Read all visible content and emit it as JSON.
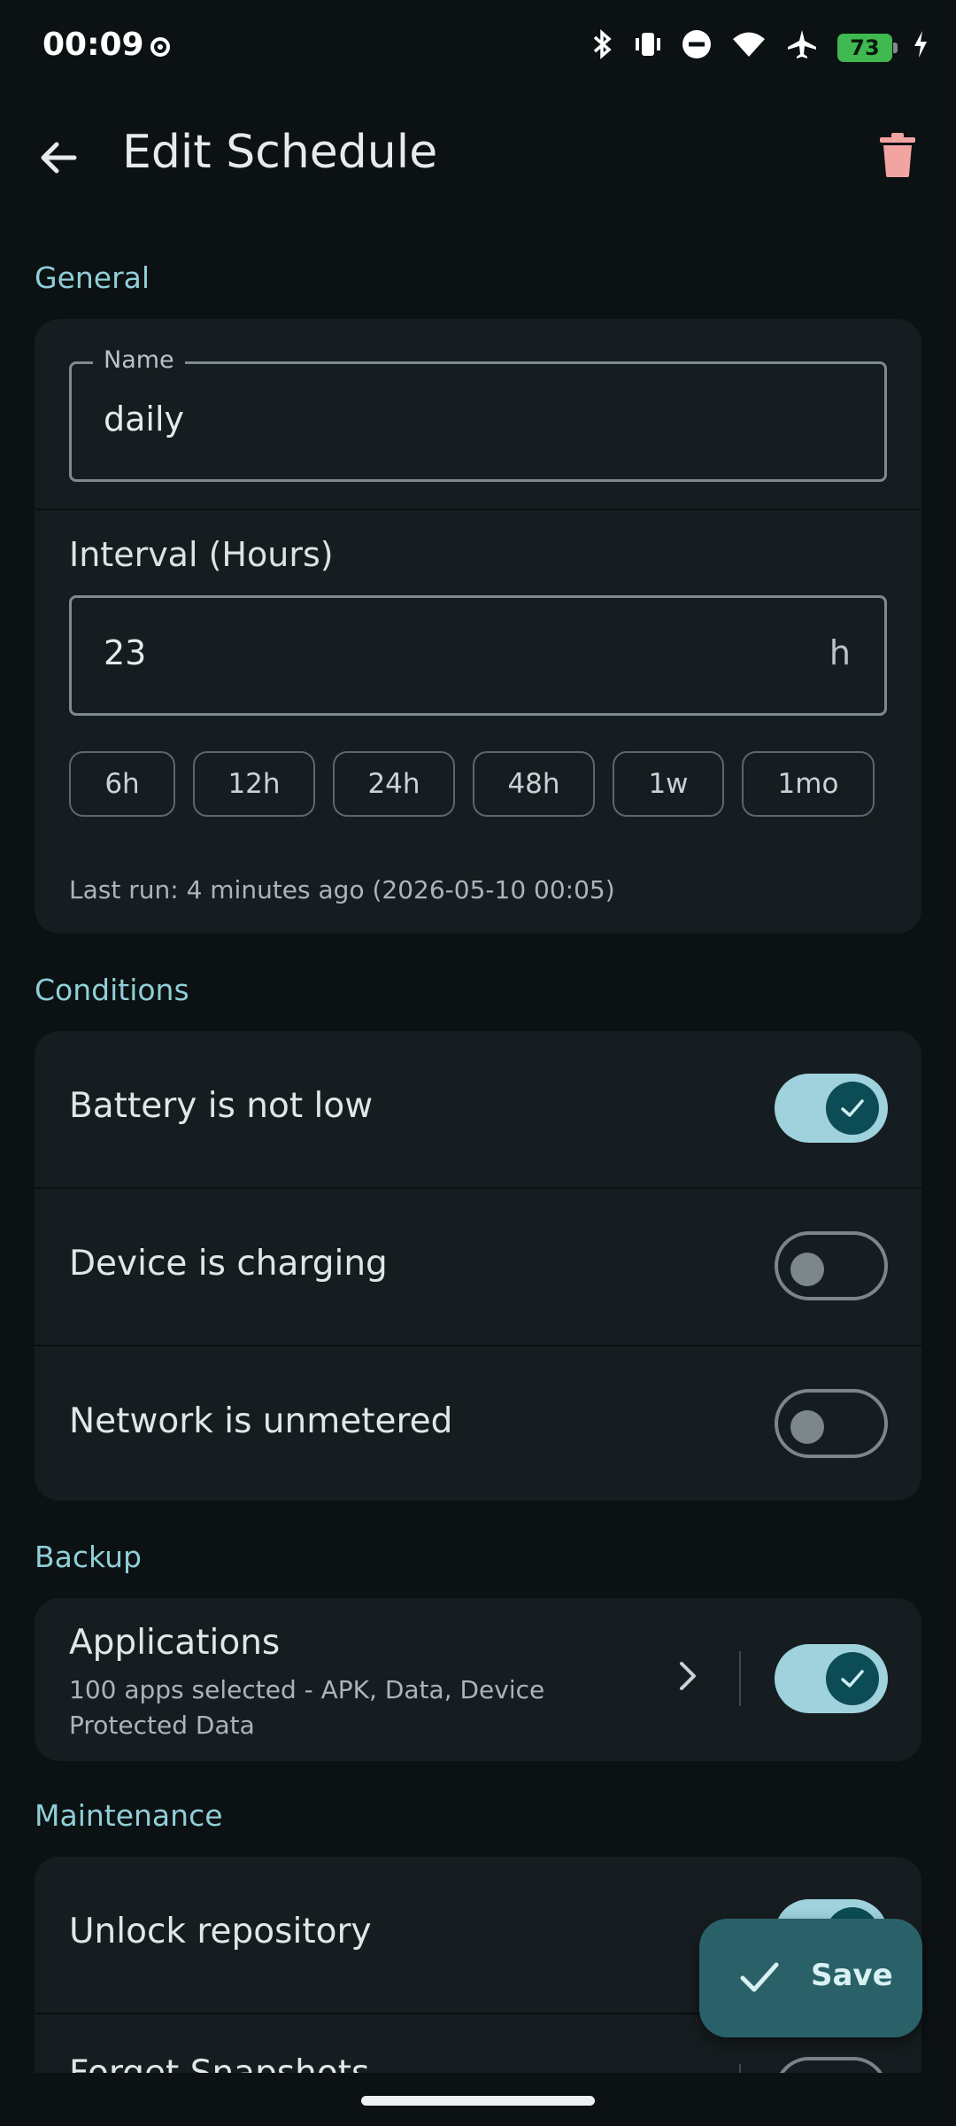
{
  "status_bar": {
    "time": "00:09",
    "battery": "73"
  },
  "app_bar": {
    "title": "Edit Schedule"
  },
  "general": {
    "section_title": "General",
    "name_label": "Name",
    "name_value": "daily",
    "interval_label": "Interval (Hours)",
    "interval_value": "23",
    "interval_suffix": "h",
    "presets": [
      "6h",
      "12h",
      "24h",
      "48h",
      "1w",
      "1mo"
    ],
    "last_run": "Last run: 4 minutes ago (2026-05-10 00:05)"
  },
  "conditions": {
    "section_title": "Conditions",
    "items": [
      {
        "label": "Battery is not low",
        "enabled": true
      },
      {
        "label": "Device is charging",
        "enabled": false
      },
      {
        "label": "Network is unmetered",
        "enabled": false
      }
    ]
  },
  "backup": {
    "section_title": "Backup",
    "applications_title": "Applications",
    "applications_subtitle": "100 apps selected - APK, Data, Device Protected Data",
    "enabled": true
  },
  "maintenance": {
    "section_title": "Maintenance",
    "items": [
      {
        "label": "Unlock repository",
        "enabled": true
      },
      {
        "label": "Forget Snapshots",
        "enabled": false
      }
    ]
  },
  "fab": {
    "label": "Save"
  },
  "colors": {
    "accent": "#8fcfd7",
    "toggle_on": "#9fd2dc",
    "fab": "#2a6168",
    "trash": "#f2a4a0"
  }
}
